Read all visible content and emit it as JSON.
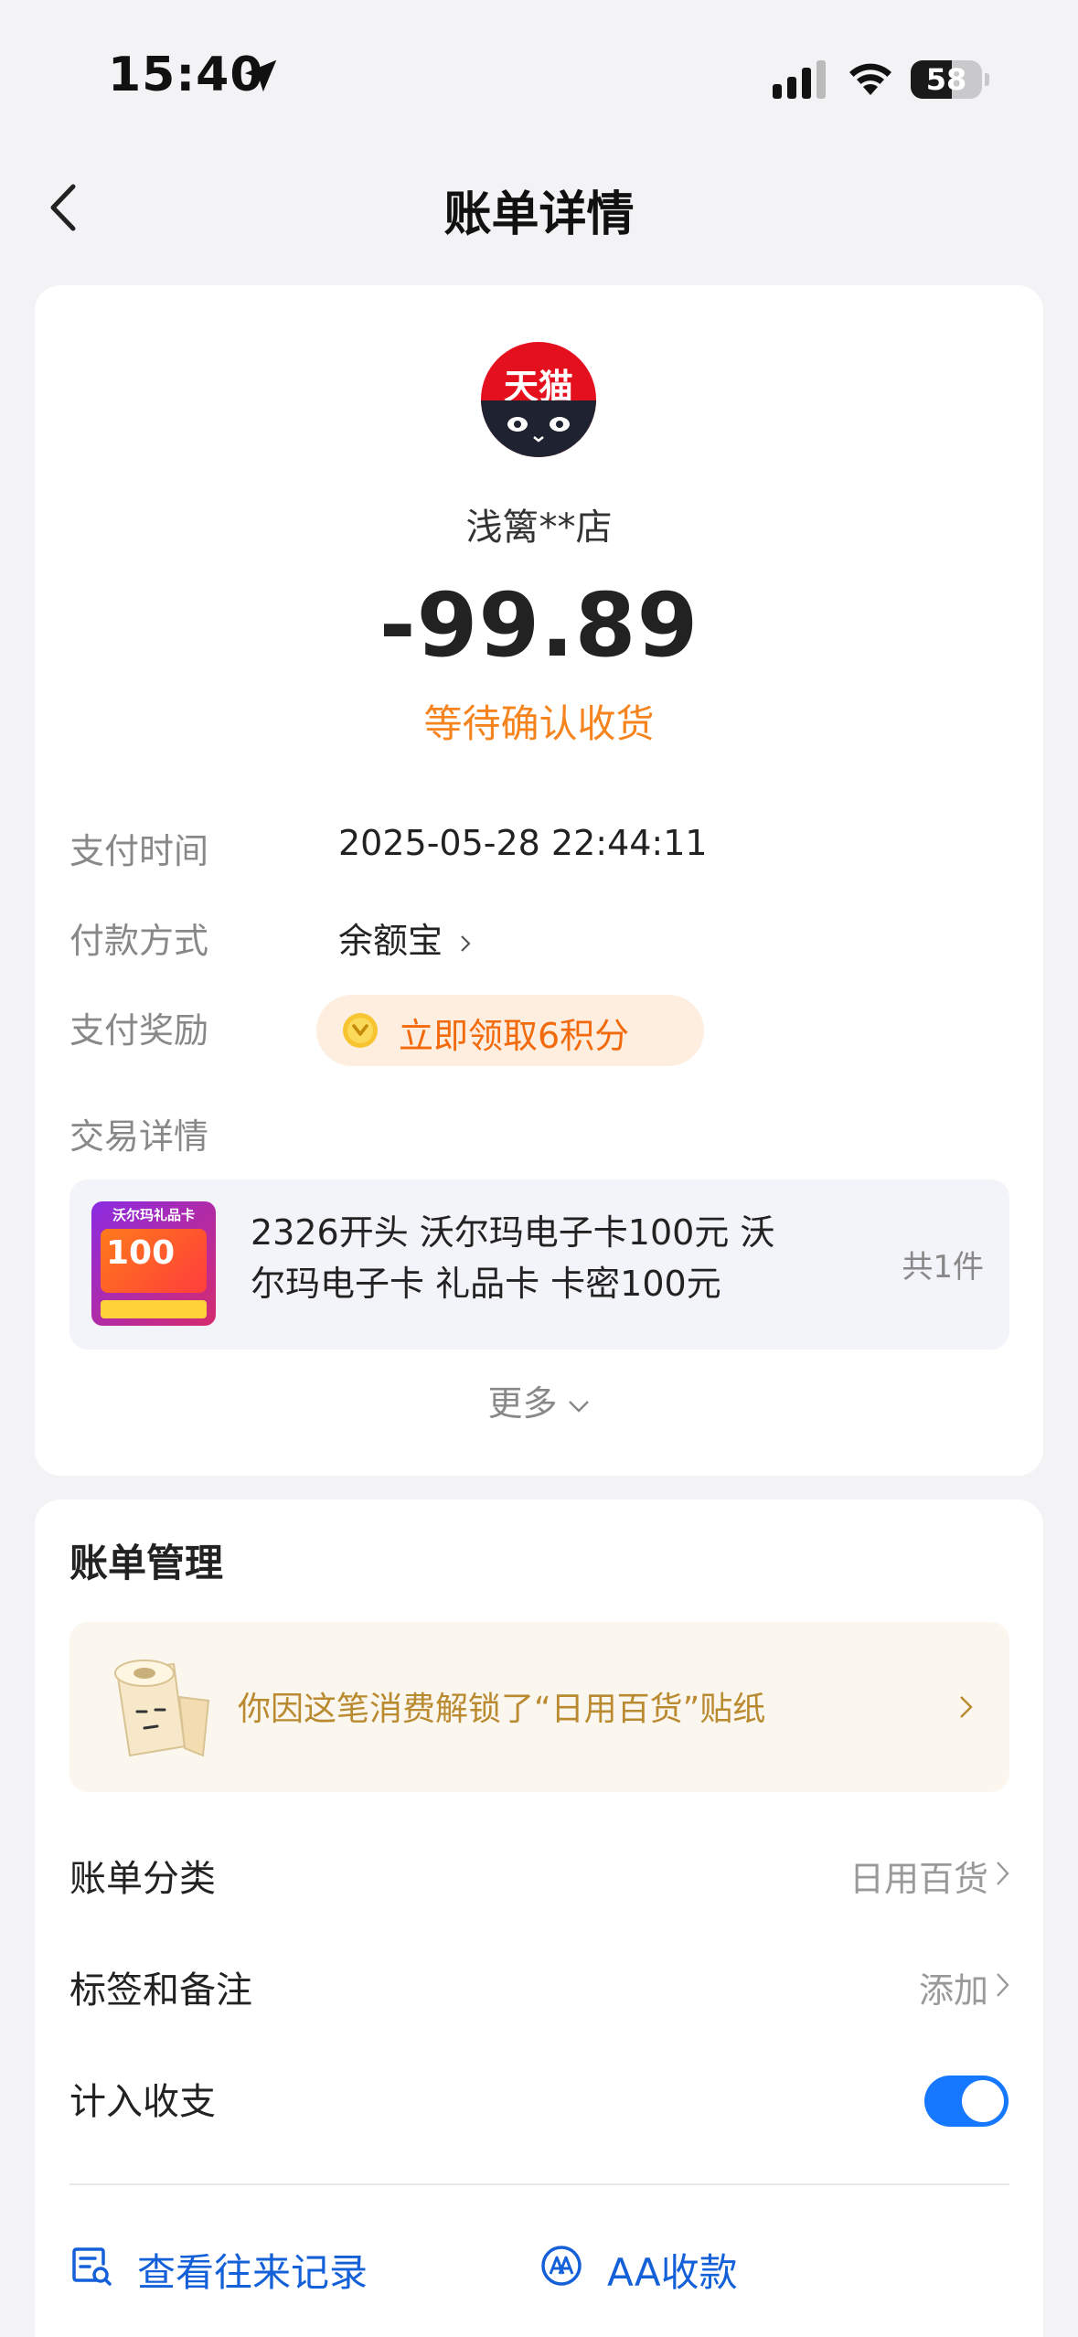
{
  "status_bar": {
    "time": "15:40",
    "battery": "58",
    "battery_level": 0.58
  },
  "nav": {
    "title": "账单详情"
  },
  "merchant": {
    "logo_text": "天猫",
    "name": "浅篱**店"
  },
  "amount": "-99.89",
  "status": "等待确认收货",
  "details": {
    "pay_time_label": "支付时间",
    "pay_time_value": "2025-05-28 22:44:11",
    "pay_method_label": "付款方式",
    "pay_method_value": "余额宝",
    "reward_label": "支付奖励",
    "reward_value": "立即领取6积分",
    "trade_label": "交易详情"
  },
  "product": {
    "thumb_title": "沃尔玛礼品卡",
    "thumb_value": "100",
    "title_line1": "2326开头 沃尔玛电子卡100元 沃",
    "title_line2": "尔玛电子卡 礼品卡 卡密100元",
    "count": "共1件"
  },
  "more_label": "更多",
  "management": {
    "title": "账单管理",
    "sticker_text": "你因这笔消费解锁了“日用百货”贴纸",
    "category_label": "账单分类",
    "category_value": "日用百货",
    "tags_label": "标签和备注",
    "tags_value": "添加",
    "include_label": "计入收支",
    "include_on": true
  },
  "actions": [
    {
      "label": "查看往来记录",
      "icon": "record-search-icon"
    },
    {
      "label": "AA收款",
      "icon": "aa-icon"
    }
  ],
  "colors": {
    "accent_blue": "#1677ff",
    "status_orange": "#f5841f",
    "reward_orange": "#f26a0c",
    "sticker_gold": "#b98a2f",
    "tmall_red": "#e4101e"
  }
}
